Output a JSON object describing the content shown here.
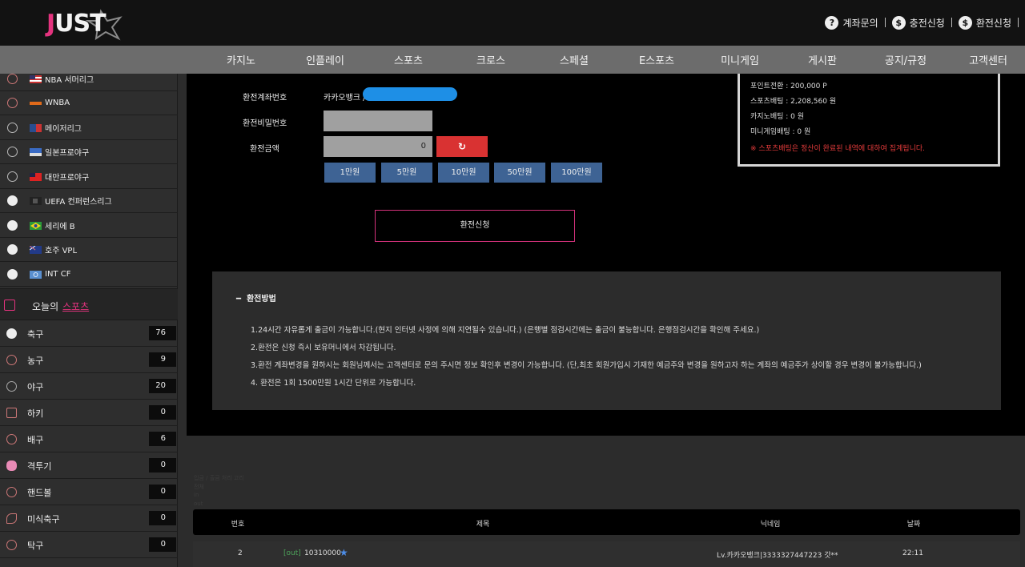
{
  "header": {
    "logo_text": "JUST",
    "links": [
      {
        "icon": "?",
        "label": "계좌문의"
      },
      {
        "icon": "$",
        "label": "충전신청"
      },
      {
        "icon": "$",
        "label": "환전신청"
      }
    ]
  },
  "nav": [
    "카지노",
    "인플레이",
    "스포츠",
    "크로스",
    "스페셜",
    "E스포츠",
    "미니게임",
    "게시판",
    "공지/규정",
    "고객센터"
  ],
  "sidebar": {
    "leagues": [
      {
        "label": "NBA 서머리그",
        "icon": "basketball-icon"
      },
      {
        "label": "WNBA",
        "icon": "basketball-icon"
      },
      {
        "label": "메이저리그",
        "icon": "baseball-icon"
      },
      {
        "label": "일본프로야구",
        "icon": "baseball-icon"
      },
      {
        "label": "대만프로야구",
        "icon": "baseball-icon"
      },
      {
        "label": "UEFA 컨퍼런스리그",
        "icon": "soccer-icon"
      },
      {
        "label": "세리에 B",
        "icon": "soccer-icon"
      },
      {
        "label": "호주 VPL",
        "icon": "soccer-icon"
      },
      {
        "label": "INT CF",
        "icon": "soccer-icon"
      }
    ],
    "today_label": "오늘의",
    "today_accent": "스포츠",
    "sports": [
      {
        "label": "축구",
        "count": "76"
      },
      {
        "label": "농구",
        "count": "9"
      },
      {
        "label": "야구",
        "count": "20"
      },
      {
        "label": "하키",
        "count": "0"
      },
      {
        "label": "배구",
        "count": "6"
      },
      {
        "label": "격투기",
        "count": "0"
      },
      {
        "label": "핸드볼",
        "count": "0"
      },
      {
        "label": "미식축구",
        "count": "0"
      },
      {
        "label": "탁구",
        "count": "0"
      }
    ]
  },
  "form": {
    "account_label": "환전계좌번호",
    "account_value": "카카오뱅크 /",
    "password_label": "환전비밀번호",
    "amount_label": "환전금액",
    "amount_value": "0",
    "reset_icon": "↻",
    "amount_buttons": [
      "1만원",
      "5만원",
      "10만원",
      "50만원",
      "100만원"
    ],
    "submit_label": "환전신청"
  },
  "info": {
    "lines": [
      "포인트전환 : 200,000 P",
      "스포츠배팅 : 2,208,560 원",
      "카지노배팅 : 0 원",
      "미니게임배팅 : 0 원"
    ],
    "note": "※ 스포츠배팅은 정산이 완료된 내역에 대하여 집계됩니다."
  },
  "method": {
    "title": "환전방법",
    "lines": [
      "1.24시간 자유롭게 출금이 가능합니다.(현지 인터넷 사정에 의해 지연될수 있습니다.) (은행별 점검시간에는 출금이 불능합니다. 은행점검시간을 확인해 주세요.)",
      "2.환전은 신청 즉시 보유머니에서 차감됩니다.",
      "3.환전 계좌변경을 원하시는 회원님께서는 고객센터로 문의 주시면 정보 확인후 변경이 가능합니다. (단,최초 회원가입시 기재한 예금주와 변경을 원하고자 하는 계좌의 예금주가 상이할 경우 변경이 불가능합니다.)",
      "4. 환전은 1회 1500만원 1시간 단위로 가능합니다."
    ]
  },
  "table": {
    "faint_lines": [
      "입금 / 출금 처리 고리",
      "전체",
      "in",
      "out"
    ],
    "headers": [
      "번호",
      "제목",
      "닉네임",
      "날짜"
    ],
    "rows": [
      {
        "no": "2",
        "tag": "[out]",
        "title": "10310000",
        "nick": "Lv.카카오뱅크|3333327447223 갓**",
        "date": "22:11"
      }
    ]
  }
}
